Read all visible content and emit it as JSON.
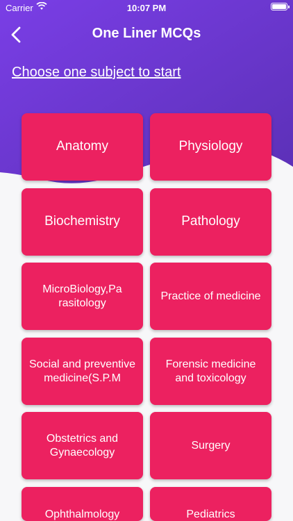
{
  "status_bar": {
    "carrier": "Carrier",
    "time": "10:07 PM"
  },
  "header": {
    "title": "One Liner MCQs",
    "subtitle": "Choose one subject to start"
  },
  "colors": {
    "gradient_start": "#7b3fe4",
    "gradient_end": "#5a2fb5",
    "card": "#ec2160"
  },
  "subjects": [
    "Anatomy",
    "Physiology",
    "Biochemistry",
    "Pathology",
    "MicroBiology,Pa rasitology",
    "Practice of medicine",
    "Social and preventive medicine(S.P.M",
    "Forensic medicine and toxicology",
    "Obstetrics and Gynaecology",
    "Surgery",
    "Ophthalmology",
    "Pediatrics"
  ]
}
